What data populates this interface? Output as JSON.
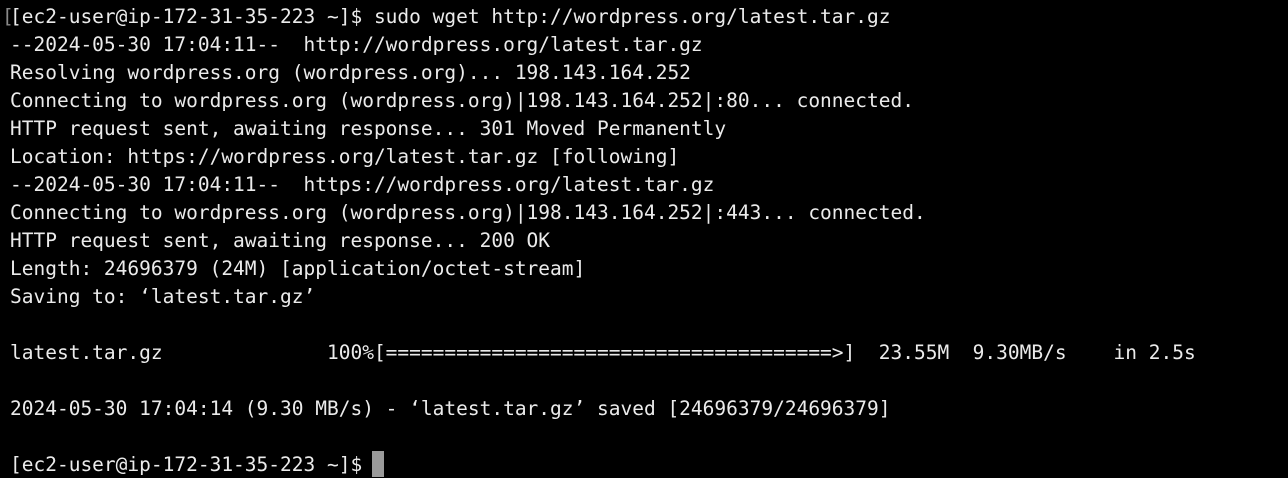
{
  "terminal": {
    "lines": [
      "[ec2-user@ip-172-31-35-223 ~]$ sudo wget http://wordpress.org/latest.tar.gz",
      "--2024-05-30 17:04:11--  http://wordpress.org/latest.tar.gz",
      "Resolving wordpress.org (wordpress.org)... 198.143.164.252",
      "Connecting to wordpress.org (wordpress.org)|198.143.164.252|:80... connected.",
      "HTTP request sent, awaiting response... 301 Moved Permanently",
      "Location: https://wordpress.org/latest.tar.gz [following]",
      "--2024-05-30 17:04:11--  https://wordpress.org/latest.tar.gz",
      "Connecting to wordpress.org (wordpress.org)|198.143.164.252|:443... connected.",
      "HTTP request sent, awaiting response... 200 OK",
      "Length: 24696379 (24M) [application/octet-stream]",
      "Saving to: ‘latest.tar.gz’",
      "",
      "latest.tar.gz              100%[======================================>]  23.55M  9.30MB/s    in 2.5s",
      "",
      "2024-05-30 17:04:14 (9.30 MB/s) - ‘latest.tar.gz’ saved [24696379/24696379]",
      "",
      "[ec2-user@ip-172-31-35-223 ~]$"
    ],
    "colors": {
      "background": "#000000",
      "foreground": "#ebebeb",
      "cursor": "#9a9a9a"
    }
  }
}
